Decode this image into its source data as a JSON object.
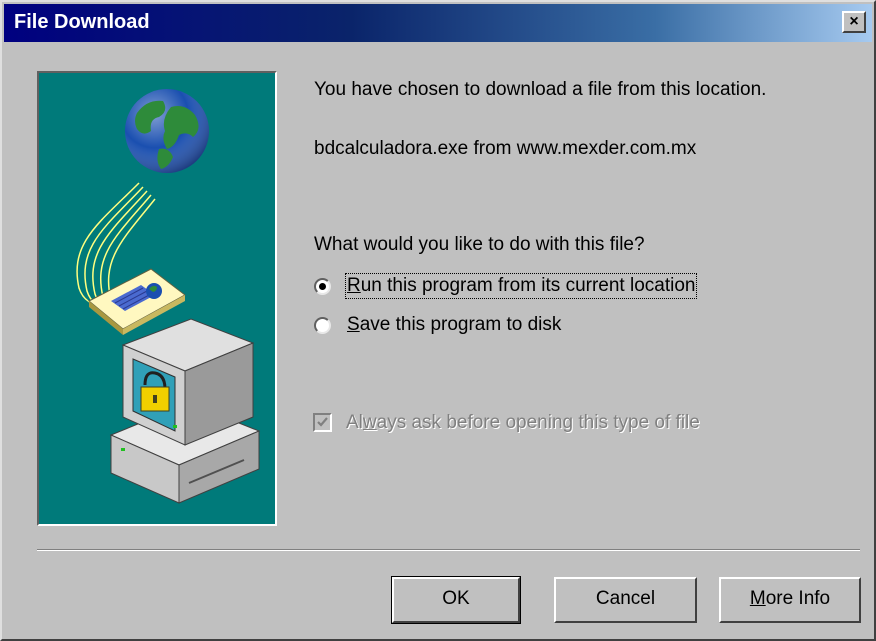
{
  "window": {
    "title": "File Download",
    "close_label": "×"
  },
  "message": {
    "intro": "You have chosen to download a file from this location.",
    "file": "bdcalculadora.exe from www.mexder.com.mx",
    "question": "What would you like to do with this file?"
  },
  "options": {
    "run_label_accesskey": "R",
    "run_label_rest": "un this program from its current location",
    "run_selected": true,
    "save_label_accesskey": "S",
    "save_label_rest": "ave this program to disk",
    "save_selected": false
  },
  "always_ask": {
    "label_prefix": "Al",
    "label_accesskey": "w",
    "label_rest": "ays ask before opening this type of file",
    "checked": true,
    "enabled": false
  },
  "buttons": {
    "ok": "OK",
    "cancel": "Cancel",
    "more_info_accesskey": "M",
    "more_info_rest": "ore Info"
  },
  "colors": {
    "illustration_bg": "#007a7a",
    "titlebar_start": "#000080",
    "face": "#c0c0c0"
  },
  "icons": [
    "close-icon",
    "globe-icon",
    "document-icon",
    "computer-icon",
    "lock-icon",
    "checkmark-icon"
  ]
}
